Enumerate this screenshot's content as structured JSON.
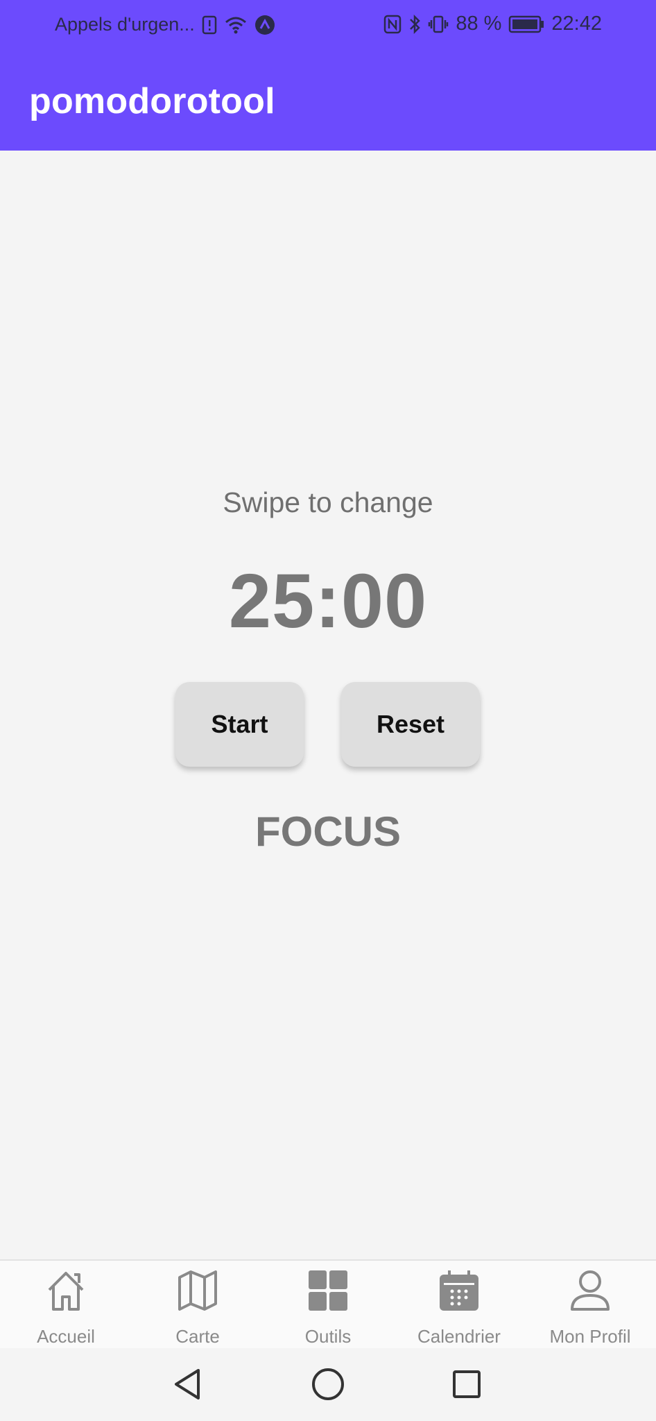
{
  "status_bar": {
    "carrier": "Appels d'urgen...",
    "battery": "88 %",
    "time": "22:42",
    "icons": [
      "sim-alert-icon",
      "wifi-icon",
      "app-notification-icon",
      "nfc-icon",
      "bluetooth-icon",
      "vibrate-icon",
      "battery-icon"
    ]
  },
  "header": {
    "title": "pomodorotool",
    "color": "#6c4bfd"
  },
  "timer": {
    "hint": "Swipe to change",
    "time": "25:00",
    "start_label": "Start",
    "reset_label": "Reset",
    "mode": "FOCUS"
  },
  "bottom_nav": {
    "items": [
      {
        "label": "Accueil",
        "icon": "home-icon"
      },
      {
        "label": "Carte",
        "icon": "map-icon"
      },
      {
        "label": "Outils",
        "icon": "grid-icon"
      },
      {
        "label": "Calendrier",
        "icon": "calendar-icon"
      },
      {
        "label": "Mon Profil",
        "icon": "person-icon"
      }
    ]
  },
  "system_nav": [
    "back-icon",
    "home-circle-icon",
    "recents-icon"
  ]
}
